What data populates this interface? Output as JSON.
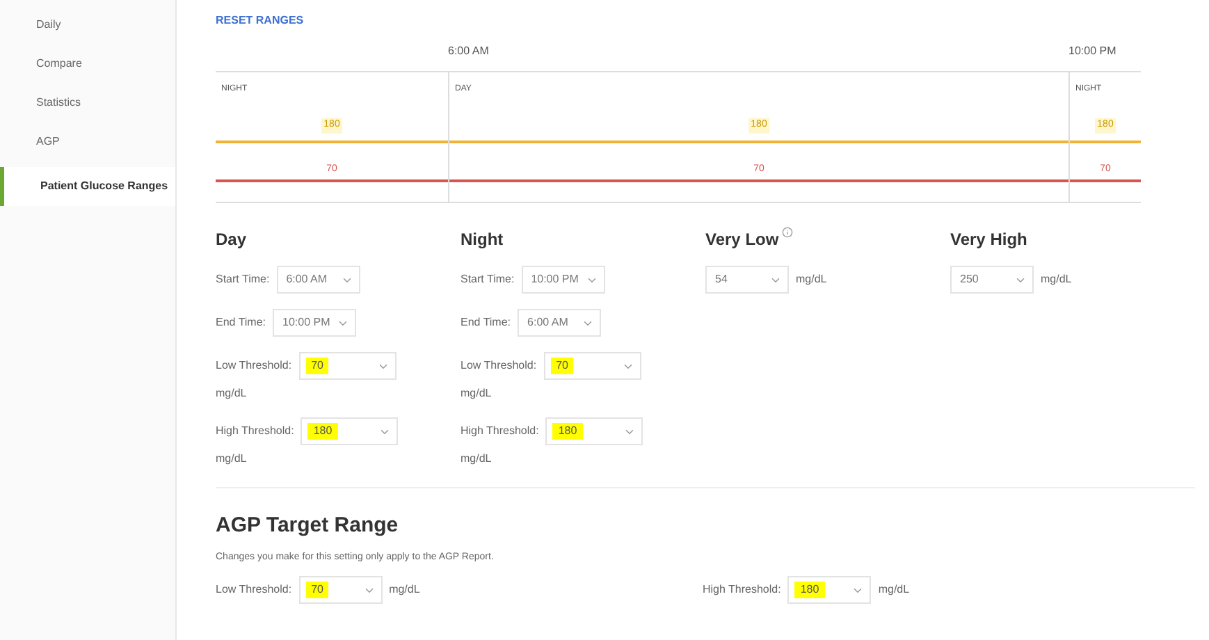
{
  "sidebar": {
    "items": [
      {
        "label": "Daily",
        "selected": false
      },
      {
        "label": "Compare",
        "selected": false
      },
      {
        "label": "Statistics",
        "selected": false
      },
      {
        "label": "AGP",
        "selected": false
      },
      {
        "label": "Patient Glucose Ranges",
        "selected": true
      }
    ]
  },
  "reset_link": "RESET RANGES",
  "timeline": {
    "time_labels": [
      "6:00 AM",
      "10:00 PM"
    ],
    "segments": [
      {
        "label": "NIGHT",
        "high": "180",
        "low": "70"
      },
      {
        "label": "DAY",
        "high": "180",
        "low": "70"
      },
      {
        "label": "NIGHT",
        "high": "180",
        "low": "70"
      }
    ]
  },
  "sections": [
    {
      "kind": "period",
      "title": "Day",
      "fields": [
        {
          "label": "Start Time:",
          "value": "6:00 AM",
          "highlighted": false
        },
        {
          "label": "End Time:",
          "value": "10:00 PM",
          "highlighted": false
        },
        {
          "label": "Low Threshold:",
          "value": "70",
          "unit": "mg/dL",
          "highlighted": true
        },
        {
          "label": "High Threshold:",
          "value": "180",
          "unit": "mg/dL",
          "highlighted": true
        }
      ]
    },
    {
      "kind": "period",
      "title": "Night",
      "fields": [
        {
          "label": "Start Time:",
          "value": "10:00 PM",
          "highlighted": false
        },
        {
          "label": "End Time:",
          "value": "6:00 AM",
          "highlighted": false
        },
        {
          "label": "Low Threshold:",
          "value": "70",
          "unit": "mg/dL",
          "highlighted": true
        },
        {
          "label": "High Threshold:",
          "value": "180",
          "unit": "mg/dL",
          "highlighted": true
        }
      ]
    },
    {
      "kind": "single",
      "title": "Very Low",
      "has_info": true,
      "value": "54",
      "unit": "mg/dL"
    },
    {
      "kind": "single",
      "title": "Very High",
      "has_info": false,
      "value": "250",
      "unit": "mg/dL"
    }
  ],
  "agp": {
    "title": "AGP Target Range",
    "description": "Changes you make for this setting only apply to the AGP Report.",
    "fields": [
      {
        "label": "Low Threshold:",
        "value": "70",
        "unit": "mg/dL",
        "highlighted": true
      },
      {
        "label": "High Threshold:",
        "value": "180",
        "unit": "mg/dL",
        "highlighted": true
      }
    ]
  }
}
